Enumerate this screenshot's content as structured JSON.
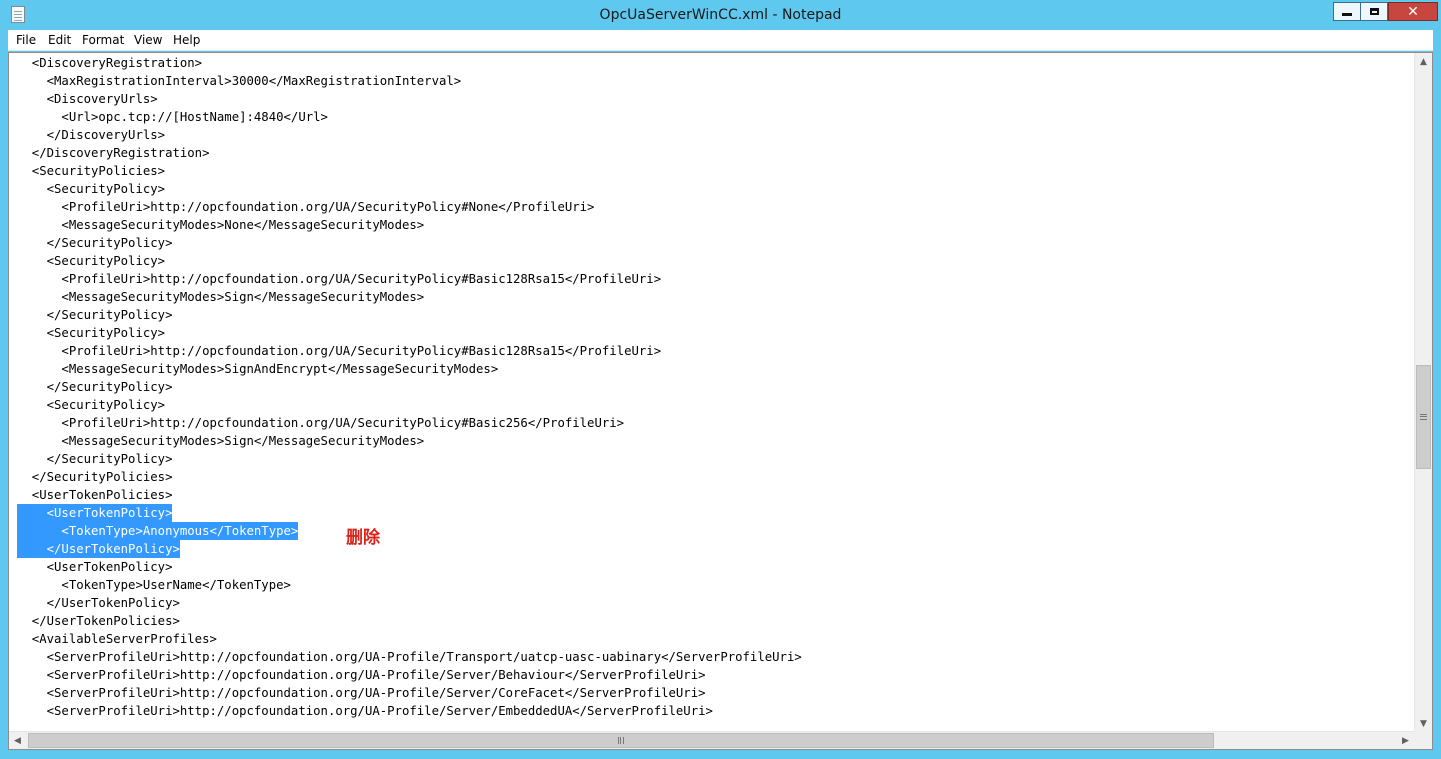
{
  "window": {
    "title": "OpcUaServerWinCC.xml - Notepad",
    "close_glyph": "✕"
  },
  "menu": [
    "File",
    "Edit",
    "Format",
    "View",
    "Help"
  ],
  "lines": [
    "  <DiscoveryRegistration>",
    "    <MaxRegistrationInterval>30000</MaxRegistrationInterval>",
    "    <DiscoveryUrls>",
    "      <Url>opc.tcp://[HostName]:4840</Url>",
    "    </DiscoveryUrls>",
    "  </DiscoveryRegistration>",
    "  <SecurityPolicies>",
    "    <SecurityPolicy>",
    "      <ProfileUri>http://opcfoundation.org/UA/SecurityPolicy#None</ProfileUri>",
    "      <MessageSecurityModes>None</MessageSecurityModes>",
    "    </SecurityPolicy>",
    "    <SecurityPolicy>",
    "      <ProfileUri>http://opcfoundation.org/UA/SecurityPolicy#Basic128Rsa15</ProfileUri>",
    "      <MessageSecurityModes>Sign</MessageSecurityModes>",
    "    </SecurityPolicy>",
    "    <SecurityPolicy>",
    "      <ProfileUri>http://opcfoundation.org/UA/SecurityPolicy#Basic128Rsa15</ProfileUri>",
    "      <MessageSecurityModes>SignAndEncrypt</MessageSecurityModes>",
    "    </SecurityPolicy>",
    "    <SecurityPolicy>",
    "      <ProfileUri>http://opcfoundation.org/UA/SecurityPolicy#Basic256</ProfileUri>",
    "      <MessageSecurityModes>Sign</MessageSecurityModes>",
    "    </SecurityPolicy>",
    "  </SecurityPolicies>",
    "  <UserTokenPolicies>",
    "    <UserTokenPolicy>",
    "      <TokenType>Anonymous</TokenType>",
    "    </UserTokenPolicy>",
    "    <UserTokenPolicy>",
    "      <TokenType>UserName</TokenType>",
    "    </UserTokenPolicy>",
    "  </UserTokenPolicies>",
    "  <AvailableServerProfiles>",
    "    <ServerProfileUri>http://opcfoundation.org/UA-Profile/Transport/uatcp-uasc-uabinary</ServerProfileUri>",
    "    <ServerProfileUri>http://opcfoundation.org/UA-Profile/Server/Behaviour</ServerProfileUri>",
    "    <ServerProfileUri>http://opcfoundation.org/UA-Profile/Server/CoreFacet</ServerProfileUri>",
    "    <ServerProfileUri>http://opcfoundation.org/UA-Profile/Server/EmbeddedUA</ServerProfileUri>"
  ],
  "selected_lines": [
    25,
    26,
    27
  ],
  "annotation": "删除",
  "colors": {
    "titlebar": "#5fc8ee",
    "selection": "#3399ff",
    "annotation": "#d9241b",
    "close_button": "#c7463d"
  },
  "scrollbars": {
    "vertical": {
      "up_glyph": "▲",
      "down_glyph": "▼"
    },
    "horizontal": {
      "left_glyph": "◀",
      "right_glyph": "▶"
    }
  }
}
